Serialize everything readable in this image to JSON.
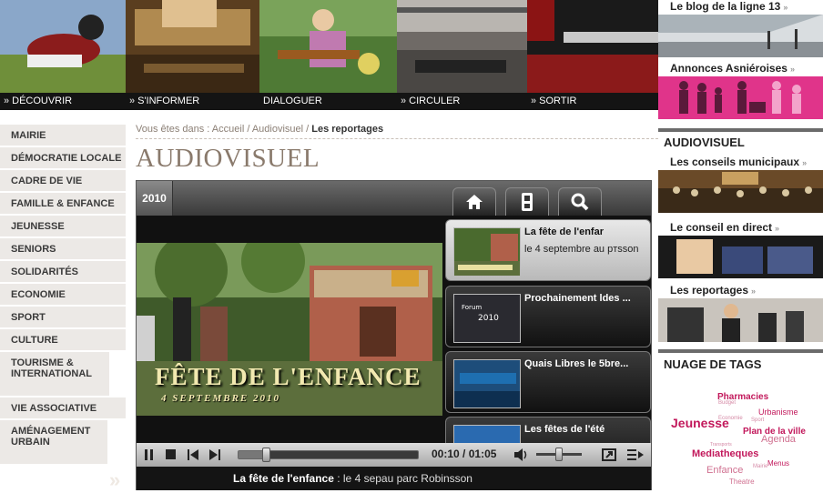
{
  "top_nav": [
    {
      "label": "DÉCOUVRIR"
    },
    {
      "label": "S'INFORMER"
    },
    {
      "label": "DIALOGUER"
    },
    {
      "label": "CIRCULER"
    },
    {
      "label": "SORTIR"
    }
  ],
  "side_nav": [
    "MAIRIE",
    "DÉMOCRATIE LOCALE",
    "CADRE DE VIE",
    "FAMILLE & ENFANCE",
    "JEUNESSE",
    "SENIORS",
    "SOLIDARITÉS",
    "ECONOMIE",
    "SPORT",
    "CULTURE",
    "TOURISME & INTERNATIONAL",
    "VIE ASSOCIATIVE",
    "AMÉNAGEMENT URBAIN"
  ],
  "breadcrumb": {
    "prefix": "Vous êtes dans : ",
    "home": "Accueil",
    "sep1": " / ",
    "section": "Audiovisuel",
    "sep2": " / ",
    "current": "Les reportages"
  },
  "page_title": "AUDIOVISUEL",
  "player": {
    "year_tab": "2010",
    "video_caption_main": "FÊTE DE L'ENFANCE",
    "video_caption_date": "4 SEPTEMBRE 2010",
    "thumb2_text_line1": "Forum",
    "thumb2_text_line2": "2010",
    "playlist": [
      {
        "title": "La fête de l'enfar",
        "desc": "le 4 septembre au pтsson"
      },
      {
        "title": "Prochainement ldes ...",
        "desc": ""
      },
      {
        "title": "Quais Libres le 5bre...",
        "desc": ""
      },
      {
        "title": "Les fêtes de l'été",
        "desc": ""
      }
    ],
    "time_current": "00:10",
    "time_sep": " / ",
    "time_total": "01:05",
    "progress": 0.15,
    "volume": 0.5,
    "caption_title": "La fête de l'enfance",
    "caption_rest": " : le 4 sepau parc Robinsson"
  },
  "right_column": {
    "blog_title": "Le blog de la ligne 13",
    "annonces_title": "Annonces Asniéroises",
    "audiovisuel_heading": "AUDIOVISUEL",
    "conseils_title": "Les conseils municipaux",
    "direct_title": "Le conseil en direct",
    "reportages_title": "Les reportages",
    "tags_heading": "NUAGE DE TAGS",
    "chevron": "»"
  },
  "tags": [
    {
      "text": "Pharmacies",
      "color": "#c2185b",
      "size": 10,
      "bold": true
    },
    {
      "text": "Budget",
      "color": "#d58aa6",
      "size": 6,
      "bold": false
    },
    {
      "text": "Urbanisme",
      "color": "#c2185b",
      "size": 9,
      "bold": false
    },
    {
      "text": "Jeunesse",
      "color": "#c2185b",
      "size": 14,
      "bold": true
    },
    {
      "text": "Sport",
      "color": "#d58aa6",
      "size": 6,
      "bold": false
    },
    {
      "text": "Economie",
      "color": "#d58aa6",
      "size": 6,
      "bold": false
    },
    {
      "text": "Plan de la ville",
      "color": "#c2185b",
      "size": 10,
      "bold": true
    },
    {
      "text": "Agenda",
      "color": "#d07090",
      "size": 11,
      "bold": false
    },
    {
      "text": "Transports",
      "color": "#d58aa6",
      "size": 5,
      "bold": false
    },
    {
      "text": "Mediatheques",
      "color": "#c2185b",
      "size": 11,
      "bold": true
    },
    {
      "text": "Menus",
      "color": "#c2185b",
      "size": 8,
      "bold": false
    },
    {
      "text": "Mairie",
      "color": "#d58aa6",
      "size": 6,
      "bold": false
    },
    {
      "text": "Enfance",
      "color": "#d07090",
      "size": 11,
      "bold": false
    },
    {
      "text": "Theatre",
      "color": "#d07090",
      "size": 8,
      "bold": false
    }
  ],
  "colors": {
    "accent": "#8a7a6c",
    "pink": "#e0348a",
    "tag": "#c2185b"
  },
  "icons": [
    "home-icon",
    "remote-icon",
    "search-icon",
    "play-icon",
    "stop-icon",
    "prev-icon",
    "next-icon",
    "volume-icon",
    "fullscreen-icon",
    "playlist-icon"
  ]
}
